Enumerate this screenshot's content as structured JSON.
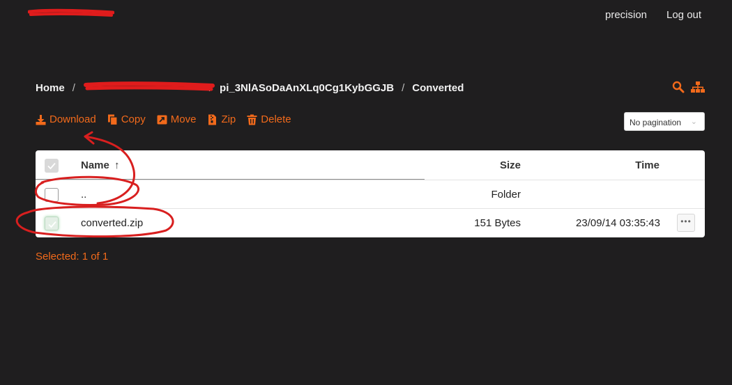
{
  "topbar": {
    "user_label": "precision",
    "logout_label": "Log out"
  },
  "breadcrumb": {
    "home": "Home",
    "folder": "pi_3NlASoDaAnXLq0Cg1KybGGJB",
    "current": "Converted",
    "separator": "/"
  },
  "actions": {
    "download": "Download",
    "copy": "Copy",
    "move": "Move",
    "zip": "Zip",
    "delete": "Delete"
  },
  "pagination": {
    "selected": "No pagination"
  },
  "table": {
    "headers": {
      "name": "Name",
      "size": "Size",
      "time": "Time"
    },
    "sort_indicator": "↑",
    "rows": [
      {
        "name": "..",
        "size": "Folder",
        "time": ""
      },
      {
        "name": "converted.zip",
        "size": "151 Bytes",
        "time": "23/09/14 03:35:43",
        "more": "•••"
      }
    ]
  },
  "status": {
    "selected": "Selected: 1 of 1"
  },
  "colors": {
    "accent": "#f26a1b",
    "background": "#1f1e1f",
    "annotation": "#d81f1f"
  },
  "icons": [
    "search-icon",
    "sitemap-icon",
    "download-icon",
    "copy-icon",
    "move-icon",
    "zip-icon",
    "delete-icon",
    "checkmark-icon",
    "more-icon"
  ]
}
